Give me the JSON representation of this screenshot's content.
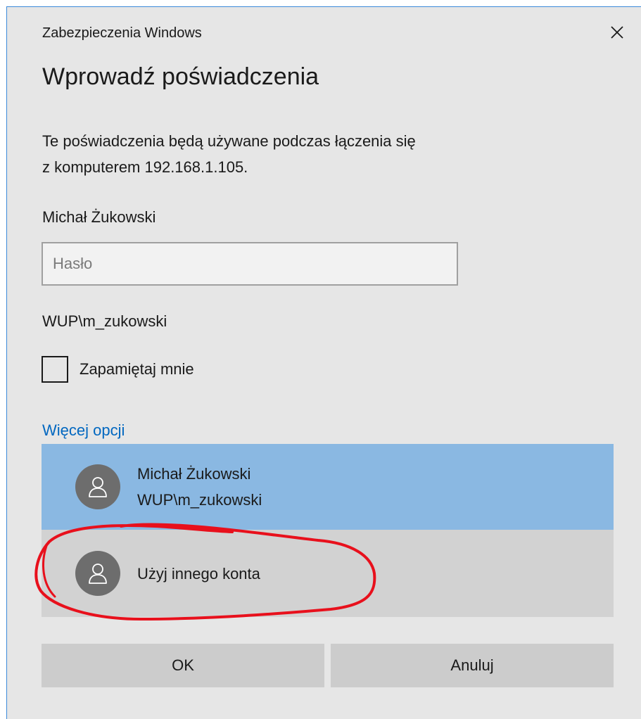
{
  "window": {
    "title": "Zabezpieczenia Windows",
    "close_icon": "close-icon"
  },
  "heading": "Wprowadź poświadczenia",
  "description": {
    "line1": "Te poświadczenia będą używane podczas łączenia się",
    "line2": "z komputerem 192.168.1.105."
  },
  "user_display_name": "Michał Żukowski",
  "password": {
    "value": "",
    "placeholder": "Hasło"
  },
  "domain_user": "WUP\\m_zukowski",
  "remember": {
    "label": "Zapamiętaj mnie",
    "checked": false
  },
  "more_options": "Więcej opcji",
  "accounts": [
    {
      "name": "Michał Żukowski",
      "login": "WUP\\m_zukowski",
      "icon": "user-avatar-icon",
      "selected": true
    },
    {
      "name": "Użyj innego konta",
      "icon": "user-avatar-icon",
      "selected": false
    }
  ],
  "buttons": {
    "ok": "OK",
    "cancel": "Anuluj"
  },
  "colors": {
    "dialog_background": "#e6e6e6",
    "selected_account": "#8ab8e2",
    "other_account": "#d2d2d2",
    "link": "#0067c0",
    "annotation": "#e8101c"
  }
}
